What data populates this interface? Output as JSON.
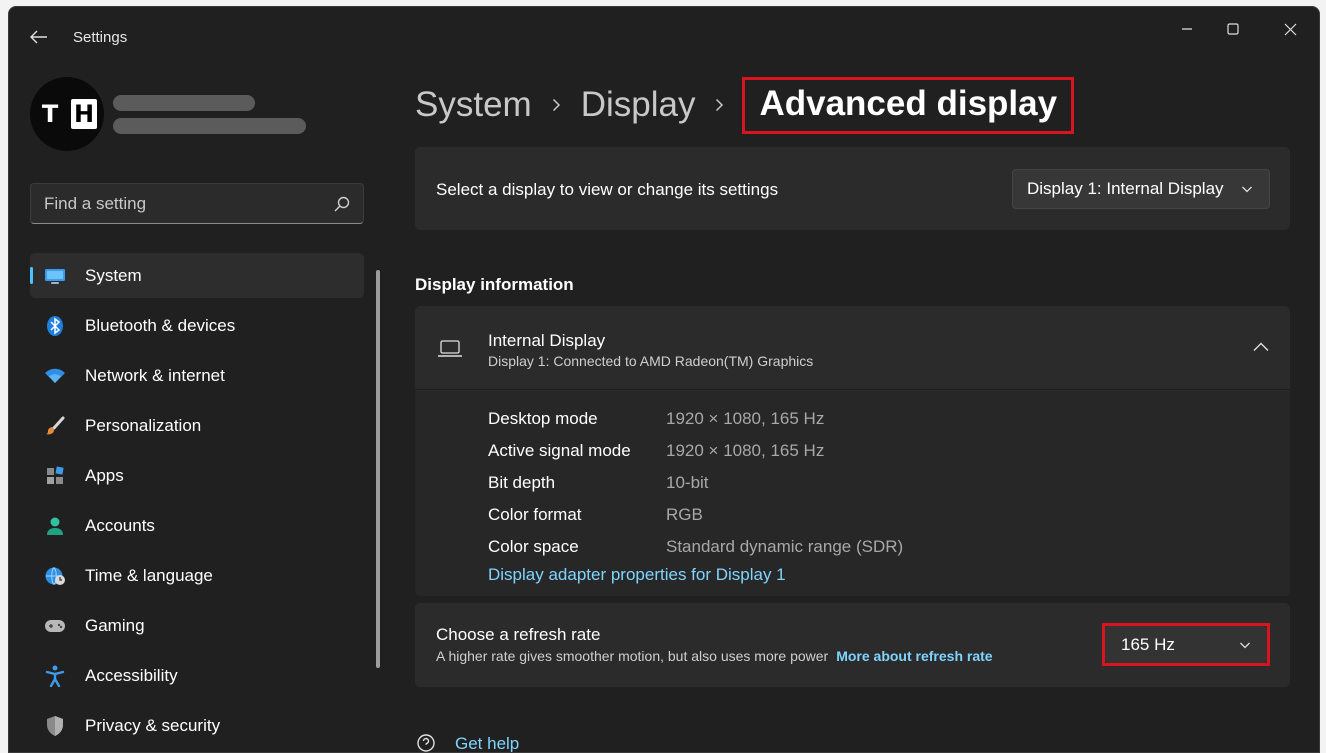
{
  "window": {
    "title": "Settings"
  },
  "profile": {
    "avatar_letters": [
      "T",
      "H"
    ]
  },
  "search": {
    "placeholder": "Find a setting"
  },
  "sidebar": {
    "items": [
      {
        "label": "System",
        "icon": "monitor-icon",
        "selected": true
      },
      {
        "label": "Bluetooth & devices",
        "icon": "bluetooth-icon"
      },
      {
        "label": "Network & internet",
        "icon": "wifi-icon"
      },
      {
        "label": "Personalization",
        "icon": "brush-icon"
      },
      {
        "label": "Apps",
        "icon": "apps-icon"
      },
      {
        "label": "Accounts",
        "icon": "person-icon"
      },
      {
        "label": "Time & language",
        "icon": "globe-clock-icon"
      },
      {
        "label": "Gaming",
        "icon": "gamepad-icon"
      },
      {
        "label": "Accessibility",
        "icon": "accessibility-icon"
      },
      {
        "label": "Privacy & security",
        "icon": "shield-icon"
      }
    ]
  },
  "breadcrumb": {
    "items": [
      "System",
      "Display"
    ],
    "current": "Advanced display"
  },
  "display_select": {
    "label": "Select a display to view or change its settings",
    "value": "Display 1: Internal Display"
  },
  "display_info": {
    "section_title": "Display information",
    "title": "Internal Display",
    "subtitle": "Display 1: Connected to AMD Radeon(TM) Graphics",
    "rows": [
      {
        "key": "Desktop mode",
        "value": "1920 × 1080, 165 Hz"
      },
      {
        "key": "Active signal mode",
        "value": "1920 × 1080, 165 Hz"
      },
      {
        "key": "Bit depth",
        "value": "10-bit"
      },
      {
        "key": "Color format",
        "value": "RGB"
      },
      {
        "key": "Color space",
        "value": "Standard dynamic range (SDR)"
      }
    ],
    "adapter_link": "Display adapter properties for Display 1"
  },
  "refresh_rate": {
    "title": "Choose a refresh rate",
    "description": "A higher rate gives smoother motion, but also uses more power",
    "link": "More about refresh rate",
    "value": "165 Hz"
  },
  "help": {
    "label": "Get help"
  },
  "colors": {
    "accent": "#4cc2ff",
    "link": "#7fd4ff",
    "highlight": "#d9141e",
    "background": "#202020",
    "card": "#2b2b2b"
  }
}
